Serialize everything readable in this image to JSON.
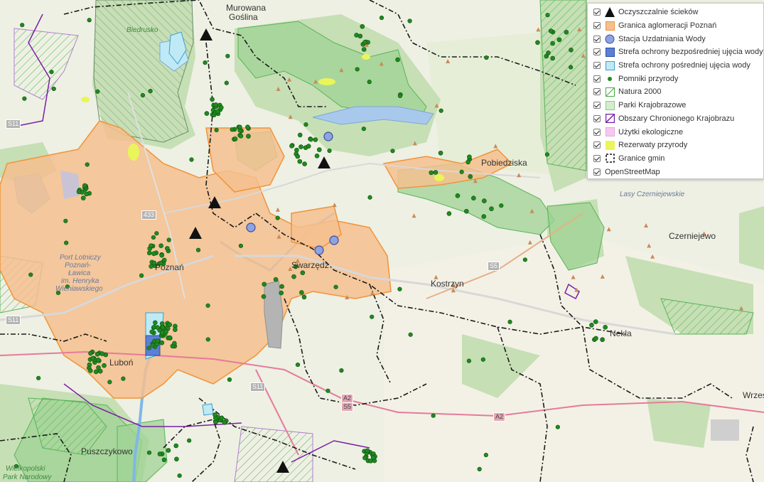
{
  "map": {
    "place_labels": [
      {
        "text": "Murowana",
        "cls": "big"
      },
      {
        "text": "Goślina",
        "cls": "big"
      },
      {
        "text": "Biedrusko",
        "cls": "green"
      },
      {
        "text": "Poznań",
        "cls": "big"
      },
      {
        "text": "Swarzędz",
        "cls": "big"
      },
      {
        "text": "Kostrzyn",
        "cls": "big"
      },
      {
        "text": "Pobiedziska",
        "cls": "big"
      },
      {
        "text": "Czerniejewo",
        "cls": "big"
      },
      {
        "text": "Nekla",
        "cls": "big"
      },
      {
        "text": "Luboń",
        "cls": "big"
      },
      {
        "text": "Puszczykowo",
        "cls": "big"
      },
      {
        "text": "Wrześ",
        "cls": "big"
      },
      {
        "text": "Port Lotniczy",
        "cls": "it"
      },
      {
        "text": "Poznań-",
        "cls": "it"
      },
      {
        "text": "Ławica",
        "cls": "it"
      },
      {
        "text": "im. Henryka",
        "cls": "it"
      },
      {
        "text": "Wieniawskiego",
        "cls": "it"
      },
      {
        "text": "Lasy Czerniejewskie",
        "cls": "it"
      },
      {
        "text": "Wielkopolski",
        "cls": "green"
      },
      {
        "text": "Park Narodowy",
        "cls": "green"
      }
    ],
    "road_labels": [
      {
        "text": "S11",
        "type": "s"
      },
      {
        "text": "S11",
        "type": "s"
      },
      {
        "text": "S11",
        "type": "s"
      },
      {
        "text": "433",
        "type": "s"
      },
      {
        "text": "S5",
        "type": "s"
      },
      {
        "text": "A2",
        "type": "a"
      },
      {
        "text": "S5",
        "type": "a"
      },
      {
        "text": "A2",
        "type": "a"
      }
    ]
  },
  "legend": {
    "items": [
      {
        "label": "Oczyszczalnie ścieków",
        "symbol": "triangle-icon"
      },
      {
        "label": "Granica aglomeracji Poznań",
        "symbol": "agglomeration-swatch"
      },
      {
        "label": "Stacja Uzdatniania Wody",
        "symbol": "circle-blue-icon"
      },
      {
        "label": "Strefa ochrony bezpośredniej ujęcia wody",
        "symbol": "blue-square-swatch"
      },
      {
        "label": "Strefa ochrony pośredniej ujęcia wody",
        "symbol": "light-blue-swatch"
      },
      {
        "label": "Pomniki przyrody",
        "symbol": "green-dot-icon"
      },
      {
        "label": "Natura 2000",
        "symbol": "hatch-green-swatch"
      },
      {
        "label": "Parki Krajobrazowe",
        "symbol": "light-green-swatch"
      },
      {
        "label": "Obszary Chronionego Krajobrazu",
        "symbol": "hatch-purple-swatch"
      },
      {
        "label": "Użytki ekologiczne",
        "symbol": "pink-swatch"
      },
      {
        "label": "Rezerwaty przyrody",
        "symbol": "yellow-swatch"
      },
      {
        "label": "Granice gmin",
        "symbol": "dashed-border-swatch"
      },
      {
        "label": "OpenStreetMap",
        "symbol": "none"
      }
    ],
    "colors": {
      "agglomeration_fill": "#f5c08f",
      "agglomeration_stroke": "#f0943a",
      "station": "#8fa3e0",
      "direct_zone": "#5b7fd6",
      "indirect_zone": "#bfeaf5",
      "monument": "#1f8a1f",
      "natura": "#3fae3f",
      "park_fill": "#a9d8a0",
      "oschk": "#7a1fa8",
      "eco": "#f6c8f0",
      "reserve": "#eaf55a"
    }
  }
}
